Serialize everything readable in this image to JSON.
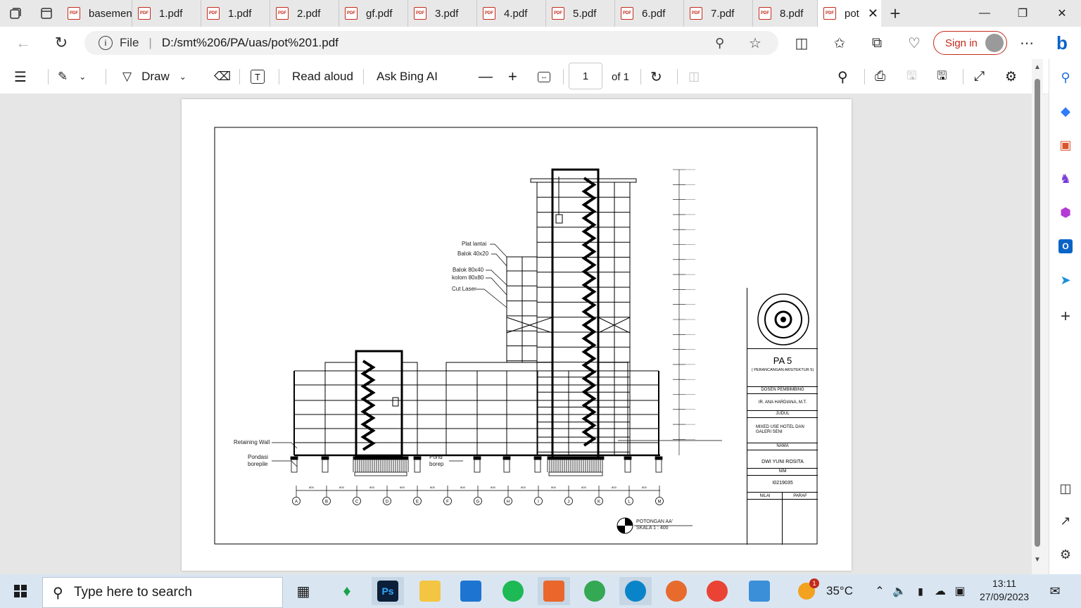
{
  "tabs": [
    {
      "label": "basemen",
      "active": false
    },
    {
      "label": "1.pdf",
      "active": false
    },
    {
      "label": "1.pdf",
      "active": false
    },
    {
      "label": "2.pdf",
      "active": false
    },
    {
      "label": "gf.pdf",
      "active": false
    },
    {
      "label": "3.pdf",
      "active": false
    },
    {
      "label": "4.pdf",
      "active": false
    },
    {
      "label": "5.pdf",
      "active": false
    },
    {
      "label": "6.pdf",
      "active": false
    },
    {
      "label": "7.pdf",
      "active": false
    },
    {
      "label": "8.pdf",
      "active": false
    },
    {
      "label": "pot",
      "active": true
    }
  ],
  "pdf_badge": "PDF",
  "address": {
    "scheme_label": "File",
    "url": "D:/smt%206/PA/uas/pot%201.pdf"
  },
  "signin_label": "Sign in",
  "toolbar": {
    "draw_label": "Draw",
    "read_aloud_label": "Read aloud",
    "ask_ai_label": "Ask Bing AI",
    "page_number": "1",
    "page_total": "of 1"
  },
  "drawing": {
    "annotations": {
      "plat_lantai": "Plat lantai",
      "balok_40x20": "Balok 40x20",
      "balok_80x40": "Balok 80x40",
      "kolom_80x80": "kolom 80x80",
      "cut_laser": "Cut Laser",
      "retaining_wall": "Retaining Wall",
      "pondasi_1": "Pondasi",
      "borepile_1": "borepile",
      "pondasi_2": "Pond",
      "borepile_2": "borep"
    },
    "grid_labels": [
      "A",
      "B",
      "C",
      "D",
      "E",
      "F",
      "G",
      "H",
      "I",
      "J",
      "K",
      "L",
      "M"
    ],
    "dimension_label": "800",
    "section_title": "POTONGAN AA'",
    "section_scale": "SKALA 1 : 400"
  },
  "titleblock": {
    "project": "PA 5",
    "subtitle": "( PERANCANGAN ARSITEKTUR 5)",
    "dosen_header": "DOSEN PEMBIMBING",
    "dosen_name": "IR. ANA HARDIANA, M.T.",
    "judul_header": "JUDUL",
    "judul_line1": "MIXED USE HOTEL DAN",
    "judul_line2": "GALERI SENI",
    "nama_header": "NAMA",
    "nama": "DWI YUNI ROSITA",
    "nim_header": "NIM",
    "nim": "I0219035",
    "nilai_header": "NILAI",
    "paraf_header": "PARAF"
  },
  "taskbar": {
    "search_placeholder": "Type here to search",
    "ps_label": "Ps",
    "weather_badge": "1",
    "temperature": "35°C",
    "time": "13:11",
    "date": "27/09/2023"
  },
  "colors": {
    "accent_red": "#c42b1c",
    "taskbar": "#d9e6f2",
    "edge_blue": "#0a64c8"
  }
}
